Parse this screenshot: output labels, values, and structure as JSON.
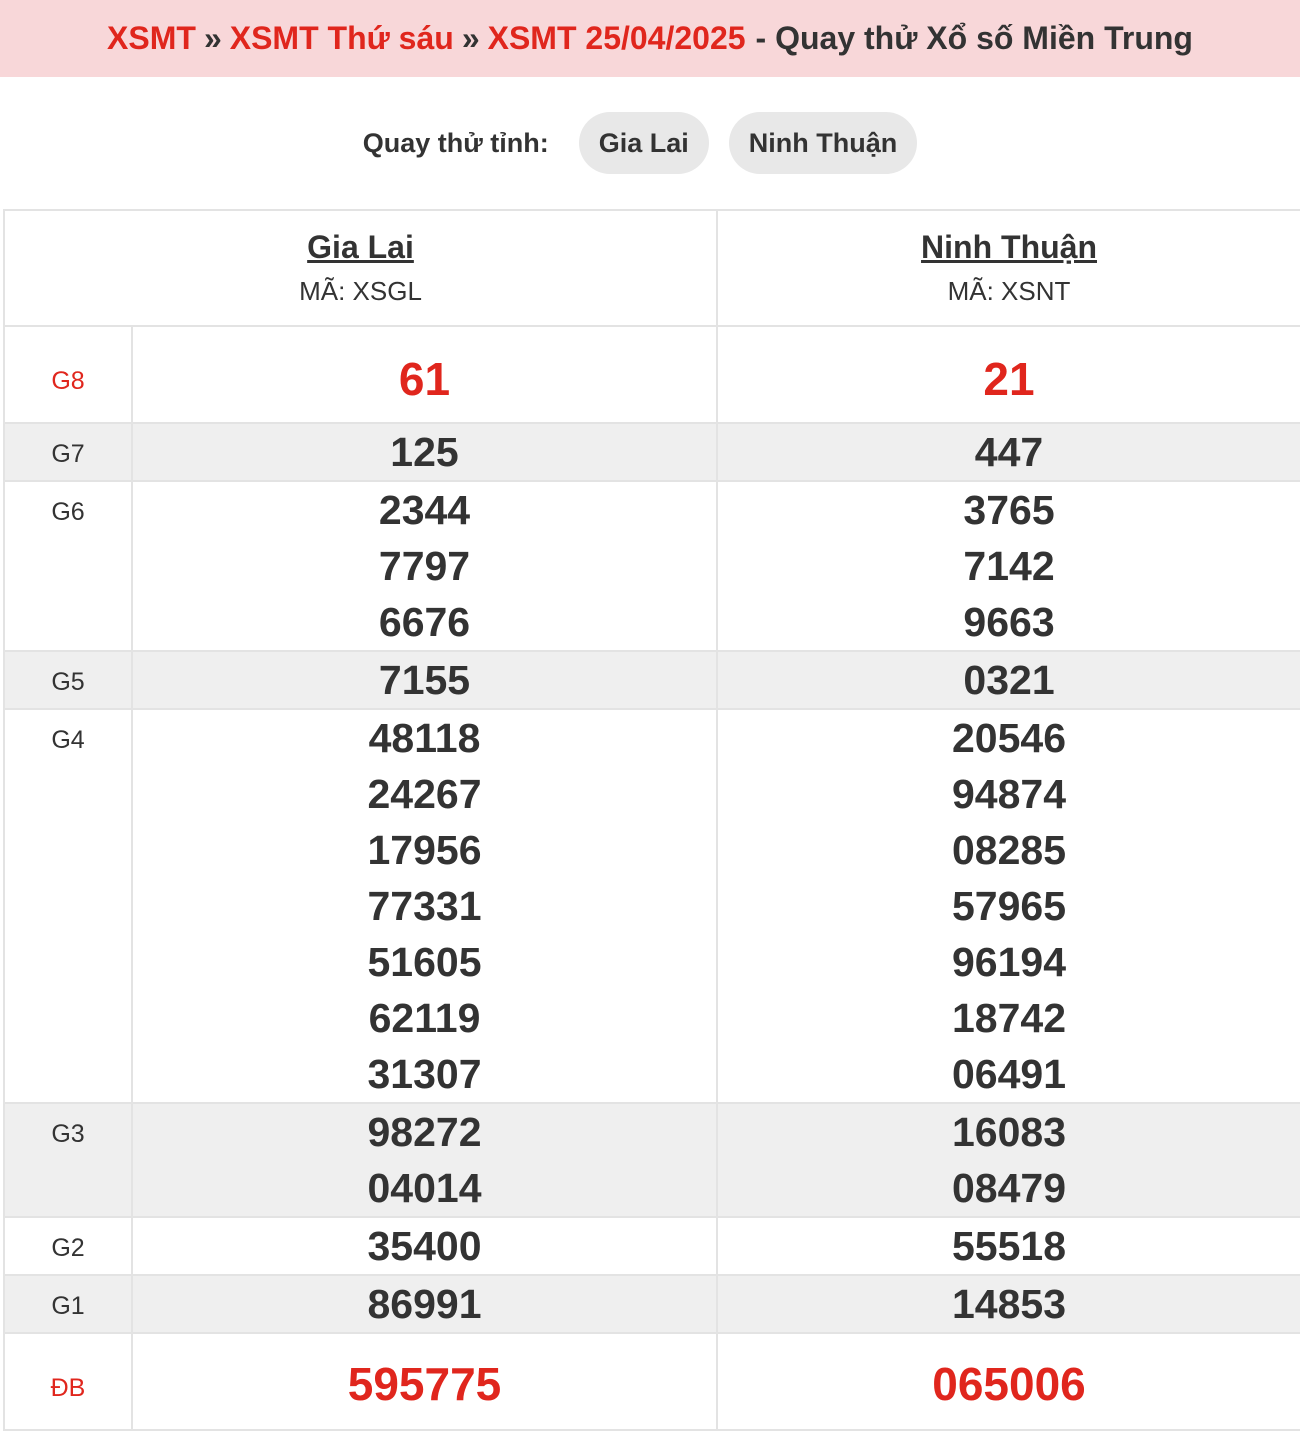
{
  "breadcrumb": {
    "items": [
      "XSMT",
      "XSMT Thứ sáu",
      "XSMT 25/04/2025"
    ],
    "separator": "»",
    "tail": "- Quay thử Xổ số Miền Trung"
  },
  "picker": {
    "label": "Quay thử tỉnh:",
    "options": [
      "Gia Lai",
      "Ninh Thuận"
    ]
  },
  "provinces": [
    {
      "name": "Gia Lai",
      "code": "MÃ: XSGL"
    },
    {
      "name": "Ninh Thuận",
      "code": "MÃ: XSNT"
    }
  ],
  "prizes": [
    {
      "label": "G8",
      "values": [
        [
          "61"
        ],
        [
          "21"
        ]
      ]
    },
    {
      "label": "G7",
      "values": [
        [
          "125"
        ],
        [
          "447"
        ]
      ]
    },
    {
      "label": "G6",
      "values": [
        [
          "2344",
          "7797",
          "6676"
        ],
        [
          "3765",
          "7142",
          "9663"
        ]
      ]
    },
    {
      "label": "G5",
      "values": [
        [
          "7155"
        ],
        [
          "0321"
        ]
      ]
    },
    {
      "label": "G4",
      "values": [
        [
          "48118",
          "24267",
          "17956",
          "77331",
          "51605",
          "62119",
          "31307"
        ],
        [
          "20546",
          "94874",
          "08285",
          "57965",
          "96194",
          "18742",
          "06491"
        ]
      ]
    },
    {
      "label": "G3",
      "values": [
        [
          "98272",
          "04014"
        ],
        [
          "16083",
          "08479"
        ]
      ]
    },
    {
      "label": "G2",
      "values": [
        [
          "35400"
        ],
        [
          "55518"
        ]
      ]
    },
    {
      "label": "G1",
      "values": [
        [
          "86991"
        ],
        [
          "14853"
        ]
      ]
    },
    {
      "label": "ĐB",
      "values": [
        [
          "595775"
        ],
        [
          "065006"
        ]
      ]
    }
  ],
  "colors": {
    "accent_red": "#e0261d",
    "header_bg": "#f8d7d9",
    "alt_row_bg": "#efefef"
  }
}
